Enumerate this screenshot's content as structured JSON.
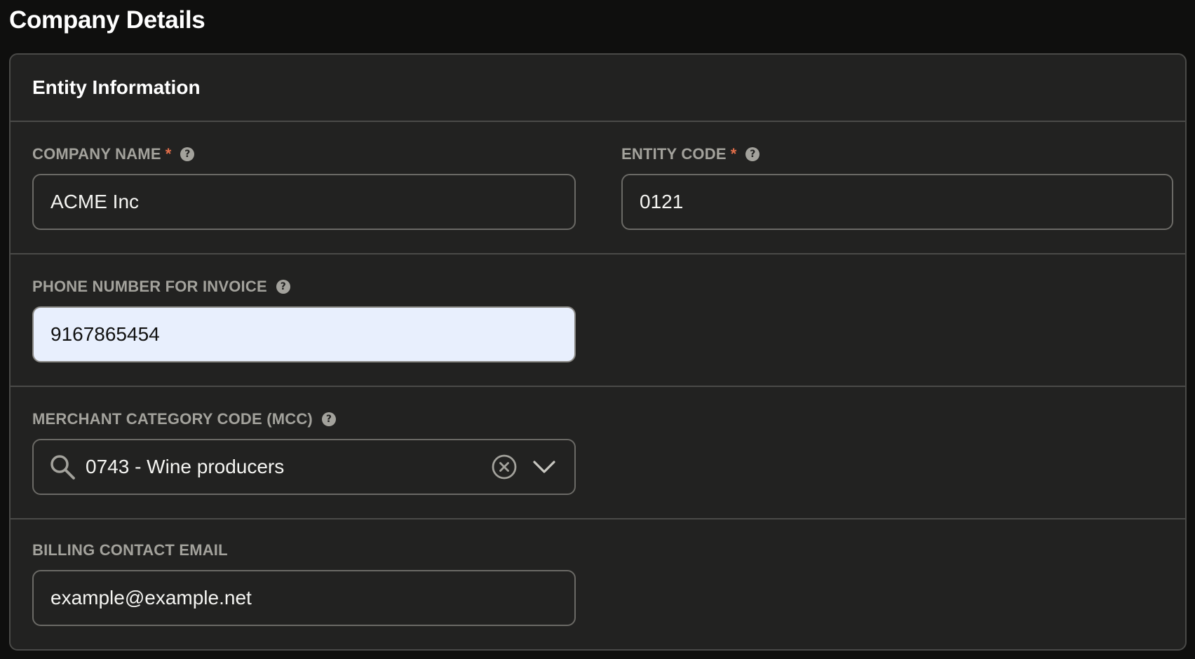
{
  "page": {
    "title": "Company Details"
  },
  "card": {
    "title": "Entity Information"
  },
  "fields": {
    "company_name": {
      "label": "COMPANY NAME",
      "required": "*",
      "value": "ACME Inc"
    },
    "entity_code": {
      "label": "ENTITY CODE",
      "required": "*",
      "value": "0121"
    },
    "phone": {
      "label": "PHONE NUMBER FOR INVOICE",
      "value": "9167865454"
    },
    "mcc": {
      "label": "MERCHANT CATEGORY CODE (MCC)",
      "value": "0743 - Wine producers"
    },
    "billing_email": {
      "label": "BILLING CONTACT EMAIL",
      "value": "example@example.net"
    }
  },
  "icons": {
    "help": "help-circle-icon",
    "search": "search-icon",
    "clear": "clear-circle-icon",
    "chevron": "chevron-down-icon"
  },
  "colors": {
    "background": "#0f0f0e",
    "card": "#222221",
    "border": "#4a4a48",
    "label": "#a3a29c",
    "required": "#e36f4a",
    "autofill": "#e8effd"
  }
}
